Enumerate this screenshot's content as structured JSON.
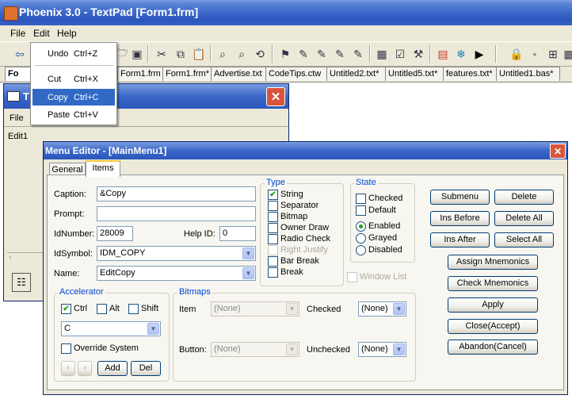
{
  "app": {
    "title": "Phoenix 3.0 - TextPad [Form1.frm]",
    "menu": [
      "File",
      "Edit",
      "Help"
    ]
  },
  "edit_menu": {
    "items": [
      {
        "label": "Undo",
        "accel": "Ctrl+Z"
      },
      {
        "label": "Cut",
        "accel": "Ctrl+X"
      },
      {
        "label": "Copy",
        "accel": "Ctrl+C"
      },
      {
        "label": "Paste",
        "accel": "Ctrl+V"
      }
    ],
    "highlighted": "Copy"
  },
  "file_tabs": [
    "Form1.frm",
    "Form1.frm",
    "Form1.frm*",
    "Advertise.txt",
    "CodeTips.ctw",
    "Untitled2.txt*",
    "Untitled5.txt*",
    "features.txt*",
    "Untitled1.bas*"
  ],
  "first_tab_partial": "Fo",
  "form_window": {
    "title_partial": "T",
    "menu_item": "File",
    "item": "Edit1"
  },
  "menu_editor": {
    "title": "Menu Editor - [MainMenu1]",
    "tabs": [
      "General",
      "Items"
    ],
    "active_tab": "Items",
    "fields": {
      "caption_label": "Caption:",
      "caption": "&Copy",
      "prompt_label": "Prompt:",
      "prompt": "",
      "idnumber_label": "IdNumber:",
      "idnumber": "28009",
      "helpid_label": "Help ID:",
      "helpid": "0",
      "idsymbol_label": "IdSymbol:",
      "idsymbol": "IDM_COPY",
      "name_label": "Name:",
      "name": "EditCopy"
    },
    "type_group": {
      "title": "Type",
      "options": [
        {
          "label": "String",
          "checked": true,
          "enabled": true
        },
        {
          "label": "Separator",
          "checked": false,
          "enabled": true
        },
        {
          "label": "Bitmap",
          "checked": false,
          "enabled": true
        },
        {
          "label": "Owner Draw",
          "checked": false,
          "enabled": true
        },
        {
          "label": "Radio Check",
          "checked": false,
          "enabled": true
        },
        {
          "label": "Right Justify",
          "checked": false,
          "enabled": false
        },
        {
          "label": "Bar Break",
          "checked": false,
          "enabled": true
        },
        {
          "label": "Break",
          "checked": false,
          "enabled": true
        }
      ]
    },
    "state_group": {
      "title": "State",
      "checks": [
        {
          "label": "Checked",
          "checked": false
        },
        {
          "label": "Default",
          "checked": false
        }
      ],
      "radios": [
        {
          "label": "Enabled",
          "selected": true
        },
        {
          "label": "Grayed",
          "selected": false
        },
        {
          "label": "Disabled",
          "selected": false
        }
      ]
    },
    "window_list": {
      "label": "Window List",
      "checked": false,
      "enabled": false
    },
    "right_buttons": [
      [
        "Submenu",
        "Delete"
      ],
      [
        "Ins Before",
        "Delete All"
      ],
      [
        "Ins After",
        "Select All"
      ]
    ],
    "action_buttons": [
      "Assign Mnemonics",
      "Check Mnemonics",
      "Apply",
      "Close(Accept)",
      "Abandon(Cancel)"
    ],
    "accelerator": {
      "title": "Accelerator",
      "ctrl": {
        "label": "Ctrl",
        "checked": true
      },
      "alt": {
        "label": "Alt",
        "checked": false
      },
      "shift": {
        "label": "Shift",
        "checked": false
      },
      "key": "C",
      "override": {
        "label": "Override System",
        "checked": false
      },
      "add_label": "Add",
      "del_label": "Del"
    },
    "bitmaps": {
      "title": "Bitmaps",
      "item_label": "Item",
      "item_value": "(None)",
      "button_label": "Button:",
      "button_value": "(None)",
      "checked_label": "Checked",
      "checked_value": "(None)",
      "unchecked_label": "Unchecked",
      "unchecked_value": "(None)"
    }
  },
  "colors": {
    "titlebar": "#2b56bd",
    "face": "#ece9d8",
    "menu_highlight": "#316ac5",
    "group_title": "#0046d5",
    "check": "#21a121"
  }
}
